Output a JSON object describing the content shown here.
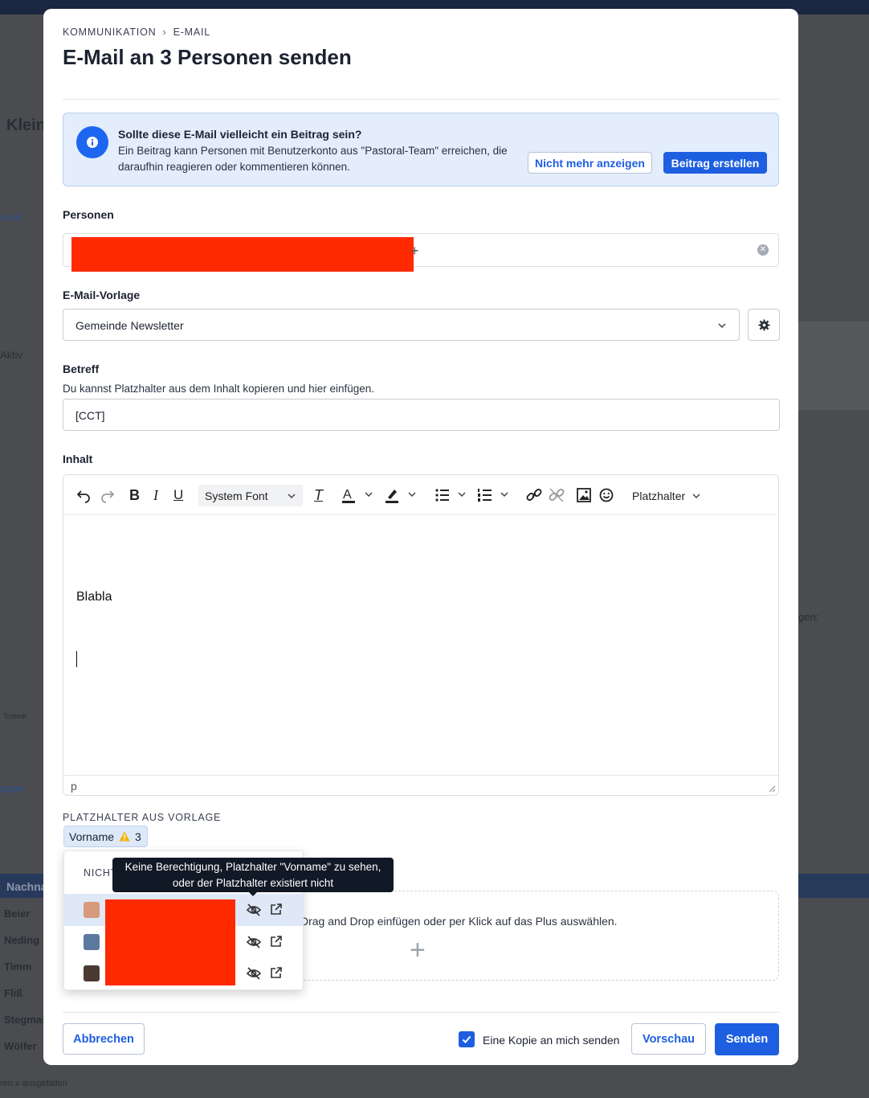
{
  "background": {
    "fragments": [
      "Klein",
      "sicht",
      "Aktiv",
      "gen:",
      "Tostedt",
      "uppe",
      "Nachna",
      "Beier",
      "Neding",
      "Timm",
      "Fliß",
      "Stegmai",
      "Wölfer",
      "ren  x ausgefallen"
    ]
  },
  "breadcrumb": {
    "parent": "KOMMUNIKATION",
    "separator": "›",
    "current": "E-MAIL"
  },
  "title": "E-Mail an 3 Personen senden",
  "info": {
    "title": "Sollte diese E-Mail vielleicht ein Beitrag sein?",
    "body": "Ein Beitrag kann Personen mit Benutzerkonto aus \"Pastoral-Team\" erreichen, die daraufhin reagieren oder kommentieren können.",
    "dismiss_label": "Nicht mehr anzeigen",
    "create_label": "Beitrag erstellen",
    "icon": "info-icon"
  },
  "persons": {
    "label": "Personen",
    "plus": "+"
  },
  "template": {
    "label": "E-Mail-Vorlage",
    "value": "Gemeinde Newsletter"
  },
  "subject": {
    "label": "Betreff",
    "hint": "Du kannst Platzhalter aus dem Inhalt kopieren und hier einfügen.",
    "value": "[CCT]"
  },
  "content": {
    "label": "Inhalt",
    "font": "System Font",
    "placeholder_menu": "Platzhalter",
    "text": "Blabla",
    "status": "p"
  },
  "placeholders": {
    "heading": "PLATZHALTER AUS VORLAGE",
    "chip_label": "Vorname",
    "chip_count": "3",
    "popover_heading": "NICHT",
    "tooltip_line1": "Keine Berechtigung, Platzhalter \"Vorname\" zu sehen,",
    "tooltip_line2": "oder der Platzhalter existiert nicht"
  },
  "attachments": {
    "text": "Drag and Drop einfügen oder per Klick auf das Plus auswählen.",
    "plus": "+"
  },
  "footer": {
    "cancel_label": "Abbrechen",
    "copy_label": "Eine Kopie an mich senden",
    "copy_checked": true,
    "preview_label": "Vorschau",
    "send_label": "Senden"
  },
  "colors": {
    "primary": "#1d5fe0",
    "info_bg": "#e3edfc",
    "redaction": "#ff2a00",
    "warning": "#f5b400"
  }
}
